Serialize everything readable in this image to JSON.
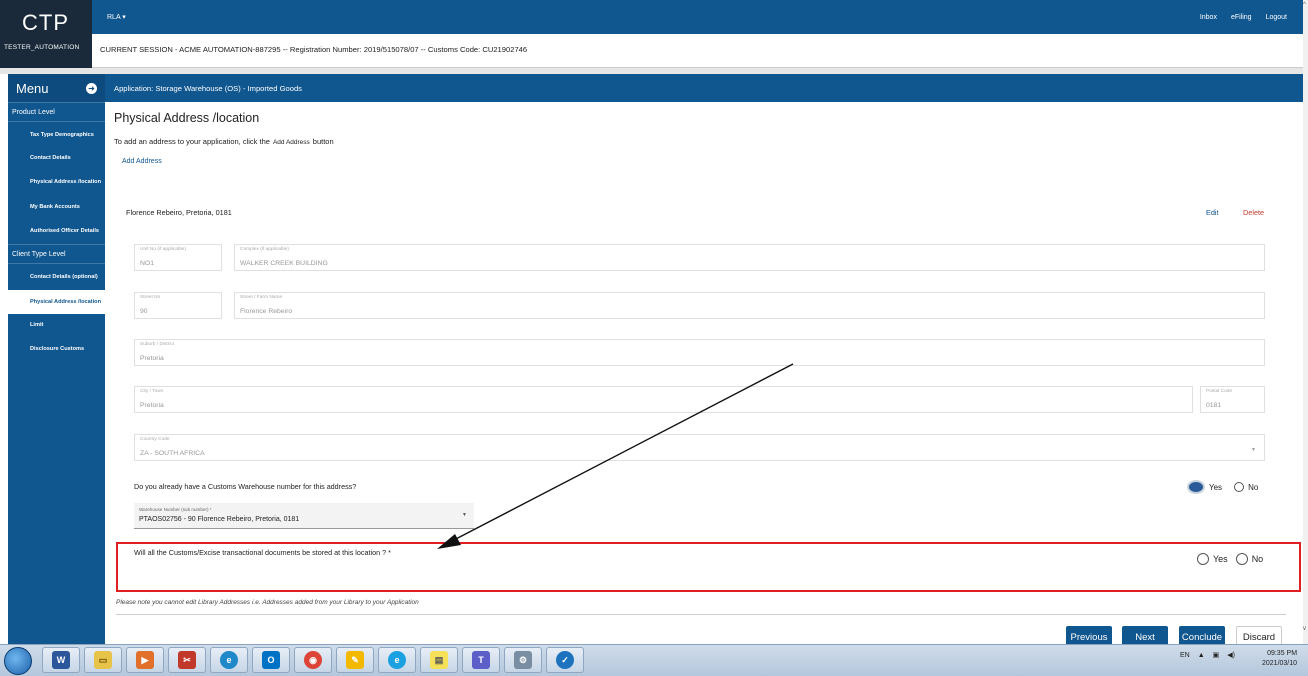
{
  "app": {
    "logo": "CTP",
    "username": "TESTER_AUTOMATION",
    "top_menu": "RLA",
    "top_links": [
      "Inbox",
      "eFiling",
      "Logout"
    ],
    "session": "CURRENT SESSION - ACME AUTOMATION-887295 -- Registration Number: 2019/515078/07 -- Customs Code: CU21902746"
  },
  "sidebar": {
    "title": "Menu",
    "product_section": "Product Level",
    "product_items": [
      "Tax Type Demographics",
      "Contact Details",
      "Physical Address /location",
      "My Bank Accounts",
      "Authorised Officer Details"
    ],
    "client_section": "Client Type Level",
    "client_items": [
      "Contact Details (optional)",
      "Physical Address /location",
      "Limit",
      "Disclosure Customs"
    ]
  },
  "header": {
    "application": "Application: Storage Warehouse (OS) - Imported Goods"
  },
  "page": {
    "title": "Physical Address /location",
    "instruction_pre": "To add an address to your application, click the",
    "instruction_btn": "Add Address",
    "instruction_post": "button",
    "add_address": "Add Address",
    "address_name": "Florence Rebeiro, Pretoria, 0181",
    "edit": "Edit",
    "delete": "Delete"
  },
  "form": {
    "unit_no": {
      "label": "Unit No (if applicable)",
      "value": "NO1"
    },
    "complex": {
      "label": "Complex (if applicable)",
      "value": "WALKER CREEK BUILDING"
    },
    "street_no": {
      "label": "Street No",
      "value": "90"
    },
    "street_name": {
      "label": "Street / Farm Name",
      "value": "Florence Rebeiro"
    },
    "suburb": {
      "label": "Suburb / District",
      "value": "Pretoria"
    },
    "city": {
      "label": "City / Town",
      "value": "Pretoria"
    },
    "postal_code": {
      "label": "Postal Code",
      "value": "0181"
    },
    "country": {
      "label": "Country Code",
      "value": "ZA - SOUTH AFRICA"
    }
  },
  "warehouse_question": {
    "text": "Do you already have a Customs Warehouse number for this address?",
    "yes": "Yes",
    "no": "No",
    "selected": "Yes"
  },
  "warehouse_select": {
    "label": "Warehouse Number (sub number) *",
    "value": "PTAOS02756 - 90 Florence Rebeiro, Pretoria, 0181"
  },
  "documents_question": {
    "text": "Will all the Customs/Excise transactional documents be stored at this location ? *",
    "yes": "Yes",
    "no": "No"
  },
  "note": "Please note  you cannot edit Library Addresses i.e. Addresses added from your Library to your Application",
  "buttons": {
    "previous": "Previous",
    "next": "Next",
    "conclude": "Conclude",
    "discard": "Discard"
  },
  "taskbar": {
    "language": "EN",
    "time": "09:35 PM",
    "date": "2021/03/10",
    "apps": [
      "word-icon",
      "file-explorer-icon",
      "media-player-icon",
      "snipping-tool-icon",
      "edge-icon",
      "outlook-icon",
      "chrome-icon",
      "paint-icon",
      "internet-explorer-icon",
      "sticky-notes-icon",
      "teams-icon",
      "network-tool-icon",
      "vpn-icon"
    ]
  },
  "colors": {
    "primary": "#10568f",
    "highlight_border": "#e02020",
    "delete": "#c0392b"
  }
}
